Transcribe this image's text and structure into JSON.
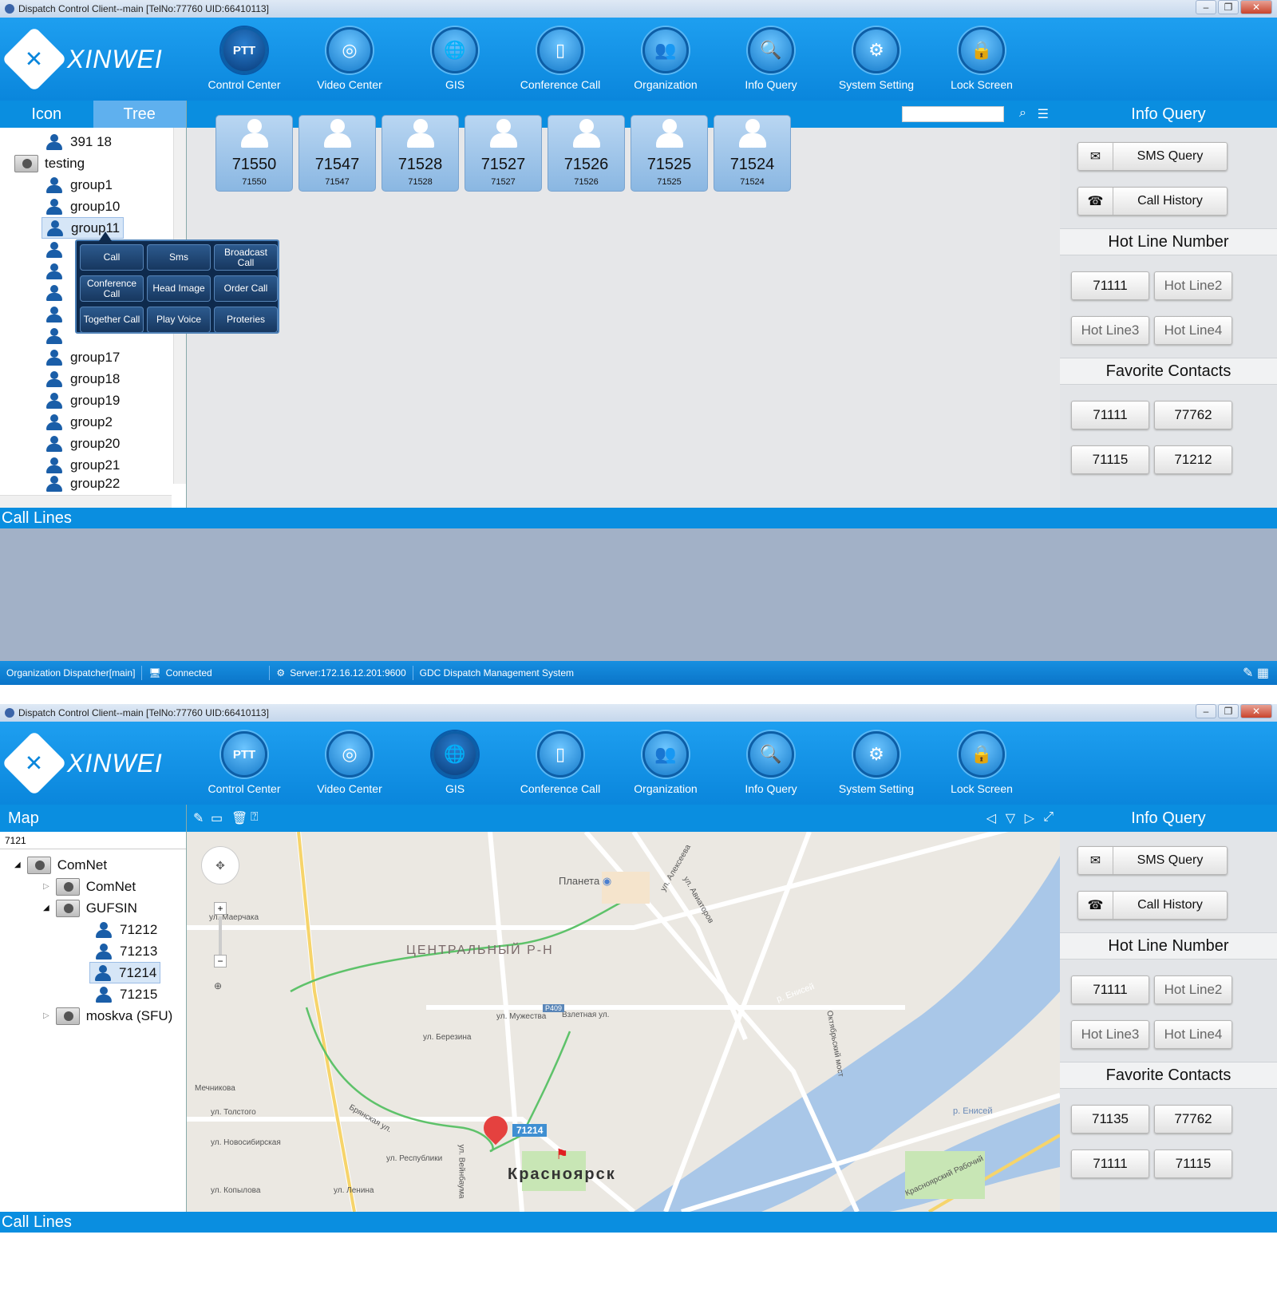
{
  "w1": {
    "title": "Dispatch Control Client--main [TelNo:77760 UID:66410113]",
    "logo": "XINWEI",
    "nav": [
      {
        "label": "Control Center",
        "icon": "PTT"
      },
      {
        "label": "Video Center",
        "icon": "video-icon"
      },
      {
        "label": "GIS",
        "icon": "globe-icon"
      },
      {
        "label": "Conference Call",
        "icon": "phone-icon"
      },
      {
        "label": "Organization",
        "icon": "people-icon"
      },
      {
        "label": "Info Query",
        "icon": "magnifier-icon"
      },
      {
        "label": "System Setting",
        "icon": "gear-icon"
      },
      {
        "label": "Lock Screen",
        "icon": "lock-icon"
      }
    ],
    "tabs": [
      "Icon",
      "Tree"
    ],
    "tree": [
      "391 18",
      "testing",
      "group1",
      "group10",
      "group11",
      "group17",
      "group18",
      "group19",
      "group2",
      "group20",
      "group21",
      "group22"
    ],
    "popup": [
      "Call",
      "Sms",
      "Broadcast Call",
      "Conference Call",
      "Head Image",
      "Order Call",
      "Together Call",
      "Play Voice",
      "Proteries"
    ],
    "cards": [
      {
        "big": "71550",
        "small": "71550"
      },
      {
        "big": "71547",
        "small": "71547"
      },
      {
        "big": "71528",
        "small": "71528"
      },
      {
        "big": "71527",
        "small": "71527"
      },
      {
        "big": "71526",
        "small": "71526"
      },
      {
        "big": "71525",
        "small": "71525"
      },
      {
        "big": "71524",
        "small": "71524"
      }
    ],
    "right": {
      "title": "Info Query",
      "sms": "SMS Query",
      "history": "Call History",
      "hotline_title": "Hot Line Number",
      "hotlines": [
        "71111",
        "Hot Line2",
        "Hot Line3",
        "Hot Line4"
      ],
      "fav_title": "Favorite Contacts",
      "favs": [
        "71111",
        "77762",
        "71115",
        "71212"
      ]
    },
    "calllines": "Call Lines",
    "status": [
      "Organization Dispatcher[main]",
      "Connected",
      "Server:172.16.12.201:9600",
      "GDC Dispatch Management System"
    ]
  },
  "w2": {
    "title": "Dispatch Control Client--main [TelNo:77760 UID:66410113]",
    "logo": "XINWEI",
    "panel_title": "Map",
    "search": "7121",
    "tree": [
      "ComNet",
      "ComNet",
      "GUFSIN",
      "71212",
      "71213",
      "71214",
      "71215",
      "moskva (SFU)"
    ],
    "map": {
      "district": "ЦЕНТРАЛЬНЫЙ Р-Н",
      "city": "Красноярск",
      "poi": "Планета",
      "marker": "71214",
      "river": "р. Енисей",
      "streets": [
        "ул. Маерчака",
        "ул. Березина",
        "ул. Мужества",
        "Взлетная ул.",
        "ул. Толстого",
        "ул. Новосибирская",
        "ул. Копылова",
        "ул. Республики",
        "ул. Ленина",
        "Брянская ул.",
        "ул. Авиаторов",
        "ул. Алексеева",
        "Октябрьский мост",
        "ул. Вейнбаума",
        "Красноярский Рабочий",
        "Мечникова",
        "Р409"
      ]
    },
    "right": {
      "title": "Info Query",
      "sms": "SMS Query",
      "history": "Call History",
      "hotline_title": "Hot Line Number",
      "hotlines": [
        "71111",
        "Hot Line2",
        "Hot Line3",
        "Hot Line4"
      ],
      "fav_title": "Favorite Contacts",
      "favs": [
        "71135",
        "77762",
        "71111",
        "71115"
      ]
    },
    "calllines": "Call Lines"
  },
  "colors": {
    "accent": "#0a8ee0",
    "header": "#1e9ff0",
    "popup": "#0e2a4d",
    "callarea": "#a2b1c7"
  }
}
